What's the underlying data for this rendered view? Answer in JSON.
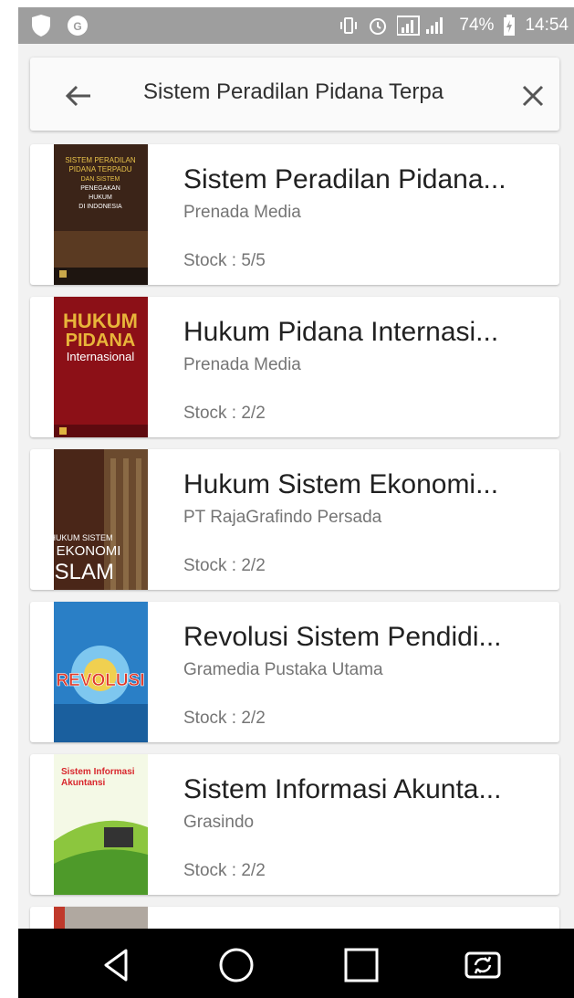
{
  "status_bar": {
    "battery": "74%",
    "time": "14:54"
  },
  "search": {
    "query": "Sistem Peradilan Pidana Terpa"
  },
  "results": [
    {
      "title": "Sistem Peradilan Pidana...",
      "publisher": "Prenada Media",
      "stock": "Stock : 5/5",
      "cover_text": [
        "SISTEM PERADILAN",
        "PIDANA TERPADU",
        "DAN SISTEM",
        "PENEGAKAN",
        "HUKUM",
        "DI INDONESIA"
      ]
    },
    {
      "title": "Hukum Pidana Internasi...",
      "publisher": "Prenada Media",
      "stock": "Stock : 2/2",
      "cover_text": [
        "HUKUM",
        "PIDANA",
        "Internasional"
      ]
    },
    {
      "title": "Hukum Sistem Ekonomi...",
      "publisher": "PT RajaGrafindo Persada",
      "stock": "Stock : 2/2",
      "cover_text": [
        "HUKUM SISTEM",
        "EKONOMI",
        "ISLAM"
      ]
    },
    {
      "title": "Revolusi Sistem Pendidi...",
      "publisher": "Gramedia Pustaka Utama",
      "stock": "Stock : 2/2",
      "cover_text": [
        "REVOLUSI"
      ]
    },
    {
      "title": "Sistem Informasi Akunta...",
      "publisher": "Grasindo",
      "stock": "Stock : 2/2",
      "cover_text": [
        "Sistem Informasi",
        "Akuntansi"
      ]
    }
  ],
  "colors": {
    "status_bar": "#9e9e9e",
    "nav_bar": "#000000",
    "card": "#ffffff",
    "background": "#f2f2f2"
  },
  "icons": {
    "back": "arrow-left-icon",
    "clear": "close-icon",
    "nav": [
      "back-triangle-icon",
      "home-circle-icon",
      "recents-square-icon",
      "screen-rotate-icon"
    ]
  }
}
